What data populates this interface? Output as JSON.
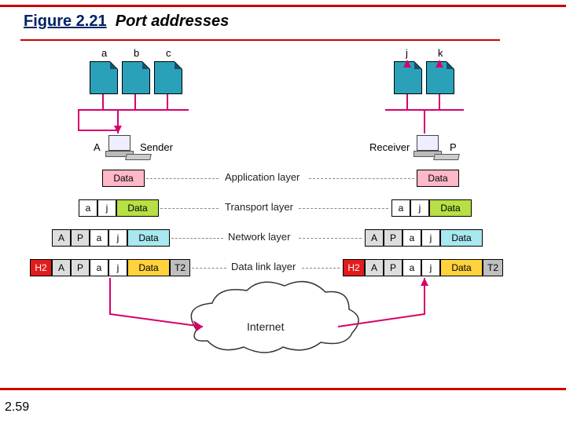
{
  "figure": {
    "number": "Figure 2.21",
    "caption": "Port addresses"
  },
  "page_number": "2.59",
  "sender": {
    "host_label_left": "A",
    "host_label_right": "Sender",
    "processes": [
      "a",
      "b",
      "c"
    ]
  },
  "receiver": {
    "host_label_left": "Receiver",
    "host_label_right": "P",
    "processes": [
      "j",
      "k"
    ]
  },
  "layers": {
    "application": "Application layer",
    "transport": "Transport layer",
    "network": "Network layer",
    "datalink": "Data link layer"
  },
  "pdu": {
    "data": "Data",
    "a": "a",
    "j": "j",
    "A": "A",
    "P": "P",
    "H2": "H2",
    "T2": "T2"
  },
  "cloud": "Internet"
}
